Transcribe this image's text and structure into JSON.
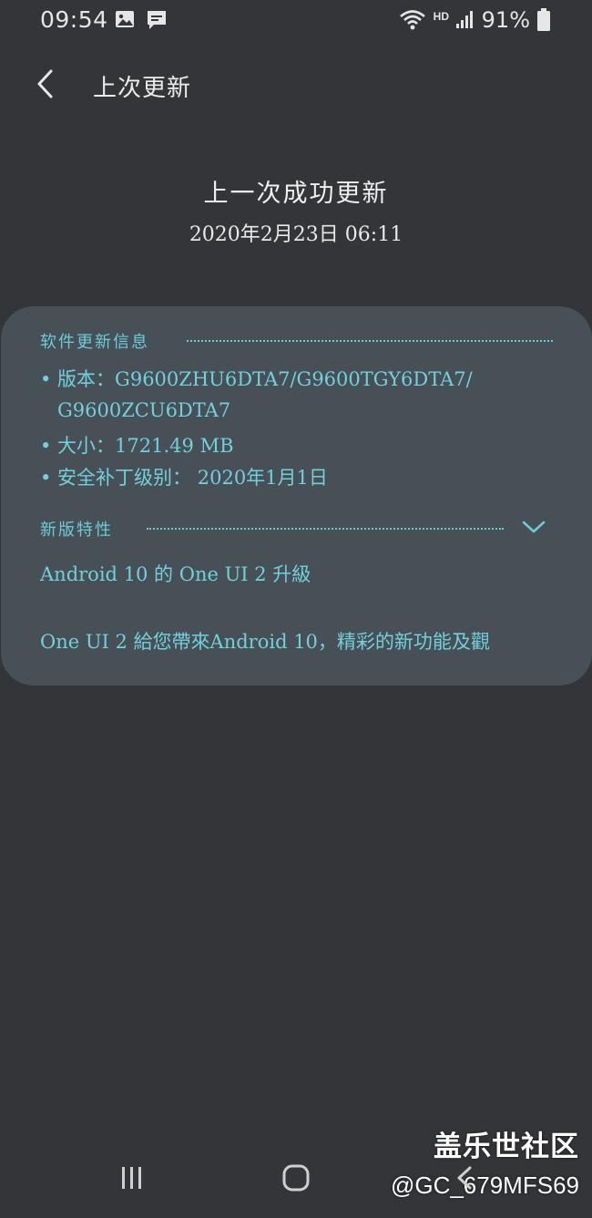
{
  "status_bar": {
    "time": "09:54",
    "network_label": "HD",
    "battery_percent": "91%",
    "icons": [
      "image-icon",
      "message-icon",
      "wifi-icon",
      "signal-icon",
      "battery-icon"
    ]
  },
  "app_bar": {
    "title": "上次更新",
    "back_icon": "back-arrow-icon"
  },
  "last_update": {
    "title": "上一次成功更新",
    "date": "2020年2月23日 06:11"
  },
  "card": {
    "software_info": {
      "header": "软件更新信息",
      "version_line1": "• 版本：G9600ZHU6DTA7/G9600TGY6DTA7/",
      "version_line2": "G9600ZCU6DTA7",
      "size_line": "• 大小：1721.49 MB",
      "security_line": "• 安全补丁级别： 2020年1月1日"
    },
    "new_features": {
      "header": "新版特性",
      "expand_icon": "chevron-down-icon",
      "line1": "Android 10 的 One UI 2 升級",
      "line2": "One UI 2 給您帶來Android 10，精彩的新功能及觀"
    }
  },
  "watermark": {
    "title": "盖乐世社区",
    "handle": "@GC_679MFS69"
  },
  "nav_bar": {
    "icons": [
      "recents-icon",
      "home-icon",
      "back-icon"
    ]
  },
  "colors": {
    "background": "#343538",
    "card": "#475057",
    "accent": "#6ecad8",
    "text": "#e8e8e8"
  }
}
